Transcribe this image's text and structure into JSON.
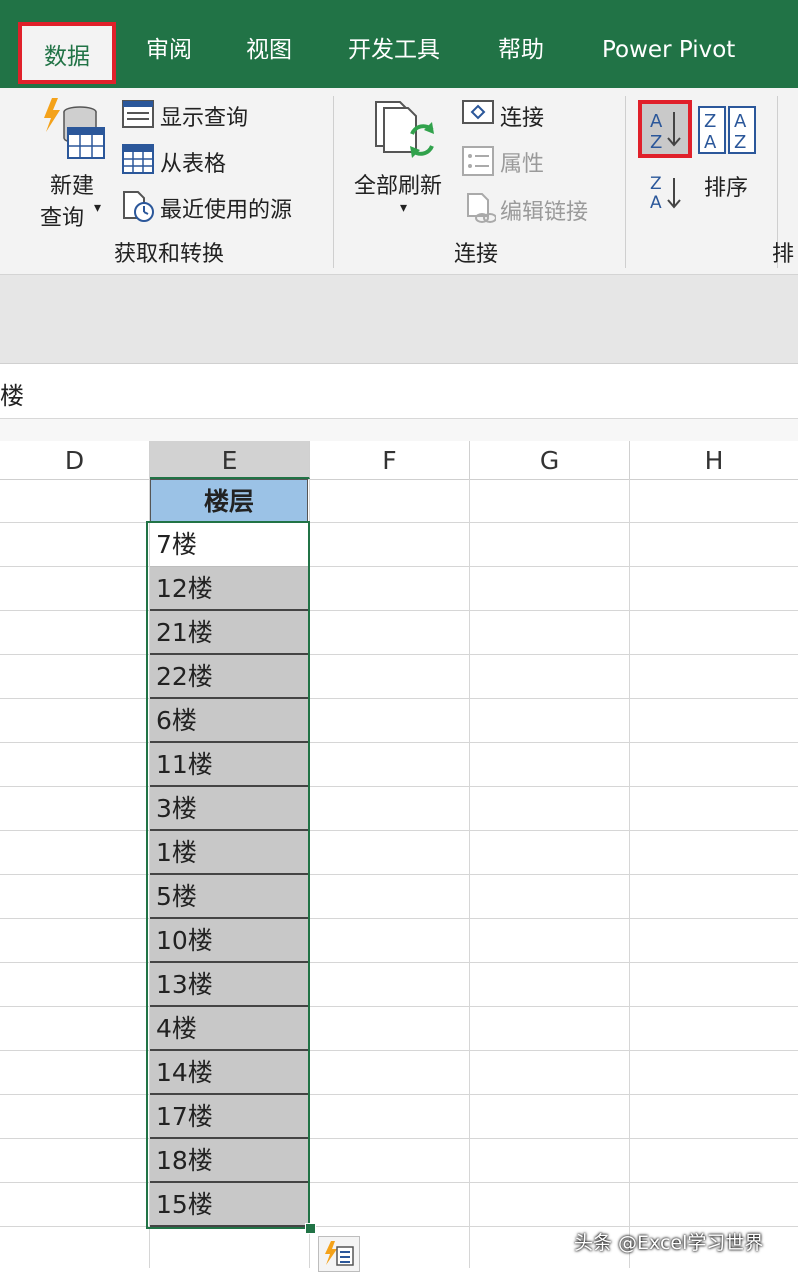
{
  "tabs": {
    "data": "数据",
    "review": "审阅",
    "view": "视图",
    "developer": "开发工具",
    "help": "帮助",
    "power_pivot": "Power Pivot"
  },
  "ribbon": {
    "get_transform": {
      "new_query_line1": "新建",
      "new_query_line2": "查询",
      "show_queries": "显示查询",
      "from_table": "从表格",
      "recent_sources": "最近使用的源",
      "group_label": "获取和转换"
    },
    "connections": {
      "refresh_all": "全部刷新",
      "connections": "连接",
      "properties": "属性",
      "edit_links": "编辑链接",
      "group_label": "连接"
    },
    "sort": {
      "sort_label": "排序",
      "group_label_partial": "排"
    }
  },
  "formula_bar": {
    "text": "楼"
  },
  "columns": [
    "D",
    "E",
    "F",
    "G",
    "H"
  ],
  "table": {
    "header": "楼层",
    "rows": [
      "7楼",
      "12楼",
      "21楼",
      "22楼",
      "6楼",
      "11楼",
      "3楼",
      "1楼",
      "5楼",
      "10楼",
      "13楼",
      "4楼",
      "14楼",
      "17楼",
      "18楼",
      "15楼"
    ]
  },
  "watermark": "头条 @Excel学习世界",
  "colors": {
    "excel_green": "#217346",
    "highlight_red": "#e0202a",
    "header_fill": "#9bc2e6",
    "selected_fill": "#c8c8c8"
  }
}
